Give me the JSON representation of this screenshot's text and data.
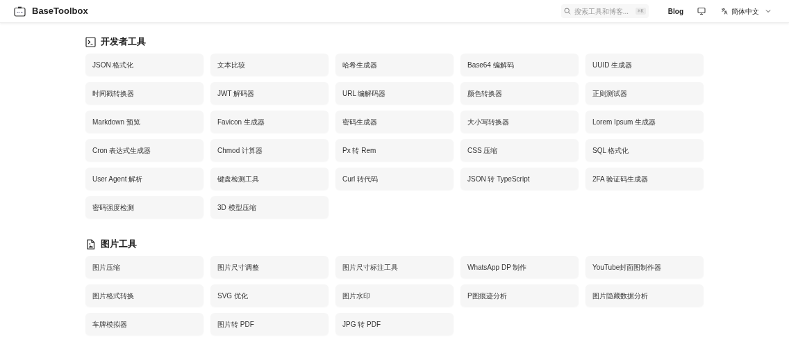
{
  "header": {
    "brand": "BaseToolbox",
    "search": {
      "placeholder": "搜索工具和博客...",
      "shortcut": "⌘K"
    },
    "nav": [
      {
        "kind": "link",
        "label": "Blog"
      },
      {
        "kind": "icon"
      },
      {
        "kind": "language",
        "label": "簡体中文"
      }
    ]
  },
  "sections": [
    {
      "title": "开发者工具",
      "tools": [
        "JSON 格式化",
        "文本比较",
        "哈希生成器",
        "Base64 编解码",
        "UUID 生成器",
        "时间戳转换器",
        "JWT 解码器",
        "URL 编解码器",
        "颜色转换器",
        "正则测试器",
        "Markdown 预览",
        "Favicon 生成器",
        "密码生成器",
        "大小写转换器",
        "Lorem Ipsum 生成器",
        "Cron 表达式生成器",
        "Chmod 计算器",
        "Px 转 Rem",
        "CSS 压缩",
        "SQL 格式化",
        "User Agent 解析",
        "键盘检测工具",
        "Curl 转代码",
        "JSON 转 TypeScript",
        "2FA 验证码生成器",
        "密码强度检测",
        "3D 模型压缩"
      ]
    },
    {
      "title": "图片工具",
      "tools": [
        "图片压缩",
        "图片尺寸调整",
        "图片尺寸标注工具",
        "WhatsApp DP 制作",
        "YouTube封面图制作器",
        "图片格式转换",
        "SVG 优化",
        "图片水印",
        "P图痕迹分析",
        "图片隐藏数据分析",
        "车牌模拟器",
        "图片转 PDF",
        "JPG 转 PDF"
      ]
    }
  ]
}
